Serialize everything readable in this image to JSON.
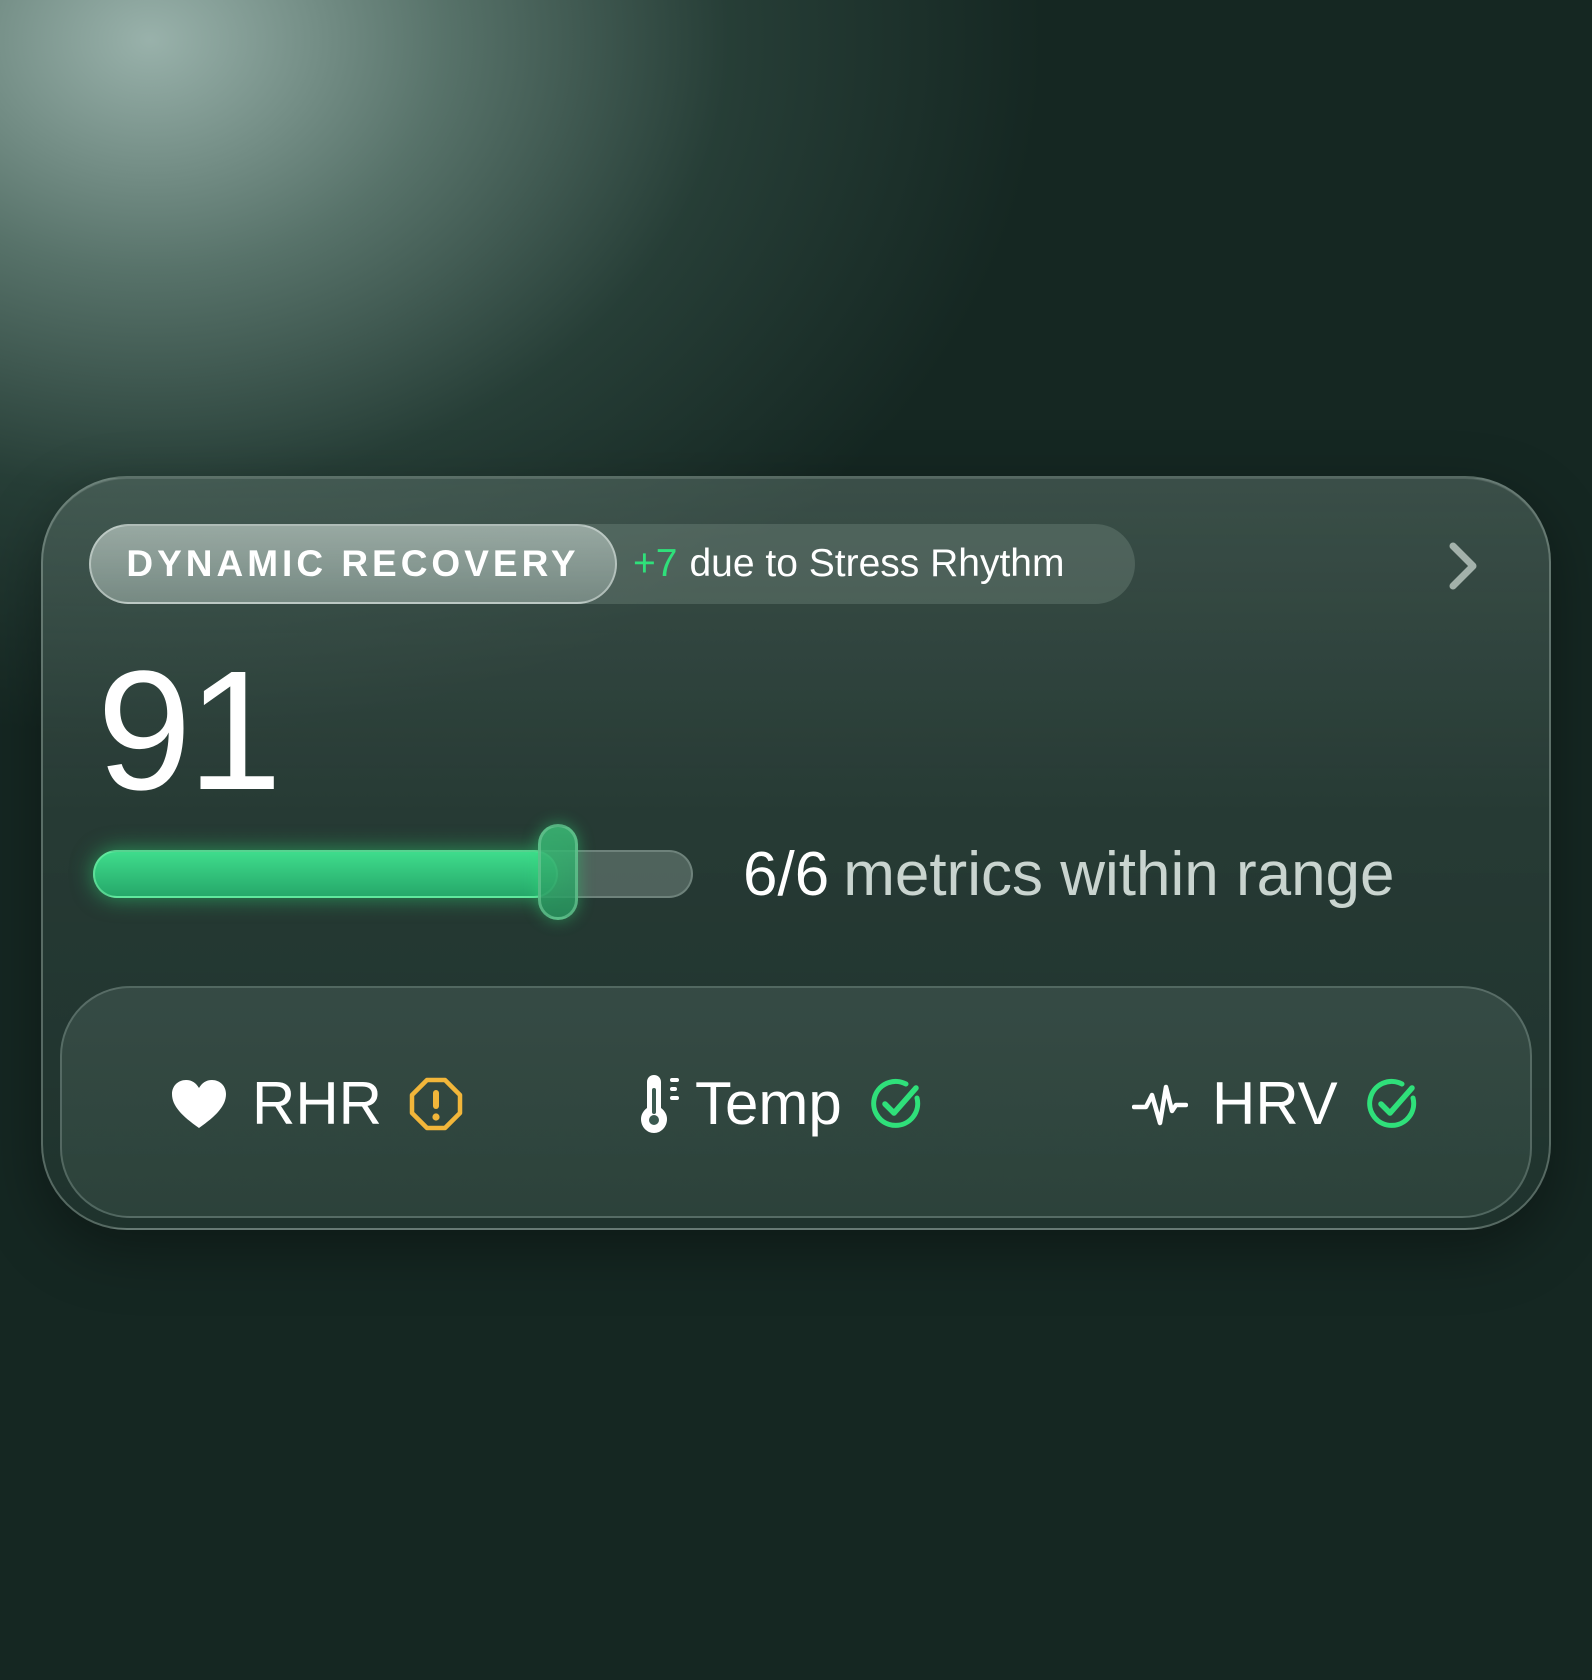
{
  "card": {
    "title": "DYNAMIC RECOVERY",
    "delta": "+7",
    "delta_reason": "due to Stress Rhythm",
    "score": "91",
    "slider_level": 0.775,
    "metrics_count": "6/6",
    "metrics_text": "metrics within range"
  },
  "metrics": [
    {
      "label": "RHR",
      "icon": "heart-icon",
      "status": "warning",
      "status_icon": "warning-octagon-icon"
    },
    {
      "label": "Temp",
      "icon": "thermometer-icon",
      "status": "ok",
      "status_icon": "check-circle-icon"
    },
    {
      "label": "HRV",
      "icon": "pulse-icon",
      "status": "ok",
      "status_icon": "check-circle-icon"
    }
  ],
  "colors": {
    "accent_green": "#2fe07a",
    "warning_amber": "#f2b63a",
    "text_primary": "#ffffff",
    "text_secondary": "#c9d4cf",
    "background": "#152722"
  }
}
